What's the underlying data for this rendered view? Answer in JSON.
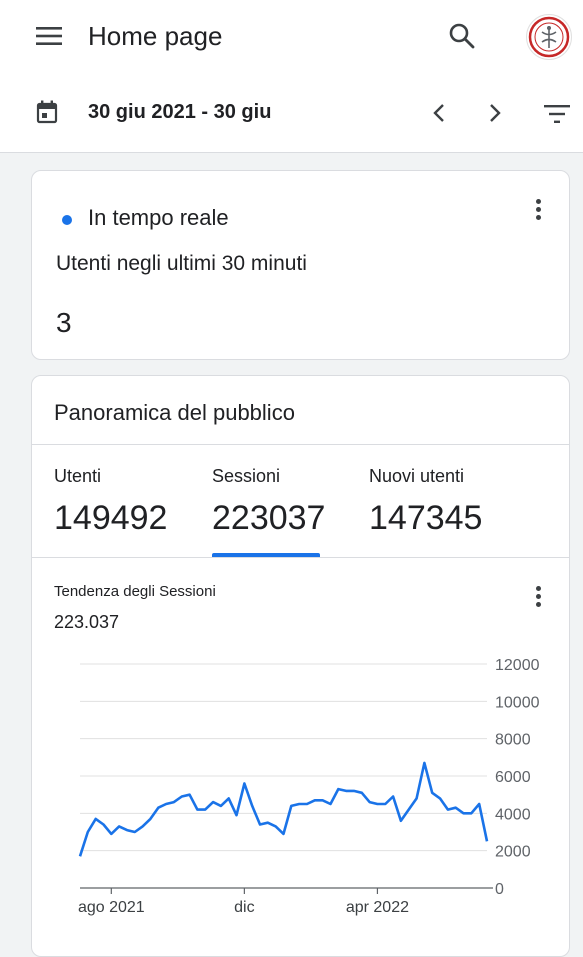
{
  "header": {
    "title": "Home page",
    "date_range": "30 giu 2021 - 30 giu"
  },
  "realtime": {
    "title": "In tempo reale",
    "subtitle": "Utenti negli ultimi 30 minuti",
    "value": "3"
  },
  "audience": {
    "title": "Panoramica del pubblico",
    "metrics": [
      {
        "label": "Utenti",
        "value": "149492"
      },
      {
        "label": "Sessioni",
        "value": "223037"
      },
      {
        "label": "Nuovi utenti",
        "value": "147345"
      }
    ],
    "selected_metric": "Sessioni",
    "trend_label": "Tendenza degli Sessioni",
    "trend_value": "223.037"
  },
  "colors": {
    "accent": "#1a73e8",
    "background": "#f1f3f4",
    "card": "#ffffff"
  },
  "icons": [
    "menu-icon",
    "search-icon",
    "avatar",
    "calendar-icon",
    "chevron-left-icon",
    "chevron-right-icon",
    "filter-icon",
    "more-vert-icon"
  ],
  "chart_data": {
    "type": "line",
    "ylim": [
      0,
      12000
    ],
    "yticks": [
      0,
      2000,
      4000,
      6000,
      8000,
      10000,
      12000
    ],
    "xticks": [
      {
        "label": "ago 2021",
        "week": 4
      },
      {
        "label": "dic",
        "week": 21
      },
      {
        "label": "apr 2022",
        "week": 38
      }
    ],
    "grid": true,
    "series": [
      {
        "values": [
          1700,
          3000,
          3700,
          3400,
          2900,
          3300,
          3100,
          3000,
          3300,
          3700,
          4300,
          4500,
          4600,
          4900,
          5000,
          4200,
          4200,
          4600,
          4400,
          4800,
          3900,
          5600,
          4400,
          3400,
          3500,
          3300,
          2900,
          4400,
          4500,
          4500,
          4700,
          4700,
          4500,
          5300,
          5200,
          5200,
          5100,
          4600,
          4500,
          4500,
          4900,
          3600,
          4200,
          4800,
          6700,
          5100,
          4800,
          4200,
          4300,
          4000,
          4000,
          4500,
          2500
        ]
      }
    ]
  }
}
